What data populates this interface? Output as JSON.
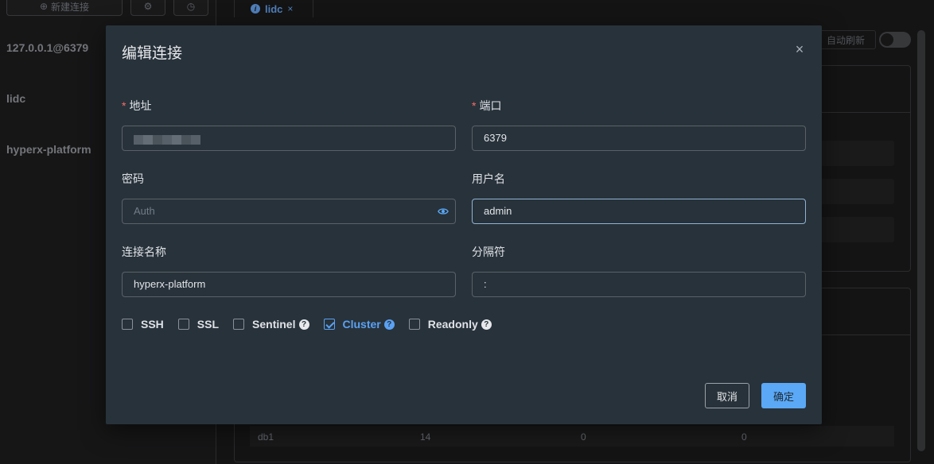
{
  "sidebar": {
    "new_connection_label": "新建连接",
    "connections": [
      {
        "label": "127.0.0.1@6379"
      },
      {
        "label": "lidc"
      },
      {
        "label": "hyperx-platform"
      }
    ]
  },
  "tab": {
    "label": "lidc",
    "close": "×"
  },
  "toolbar": {
    "auto_refresh_label": "自动刷新"
  },
  "db_row": {
    "name": "db1",
    "keys": "14",
    "expires": "0",
    "avg_ttl": "0"
  },
  "dialog": {
    "title": "编辑连接",
    "close": "×",
    "fields": {
      "address": {
        "label": "地址",
        "required_mark": "*"
      },
      "port": {
        "label": "端口",
        "required_mark": "*",
        "value": "6379"
      },
      "password": {
        "label": "密码",
        "placeholder": "Auth"
      },
      "username": {
        "label": "用户名",
        "value": "admin"
      },
      "conn_name": {
        "label": "连接名称",
        "value": "hyperx-platform"
      },
      "separator": {
        "label": "分隔符",
        "value": ":"
      }
    },
    "options": [
      {
        "label": "SSH",
        "checked": false,
        "help": false
      },
      {
        "label": "SSL",
        "checked": false,
        "help": false
      },
      {
        "label": "Sentinel",
        "checked": false,
        "help": true
      },
      {
        "label": "Cluster",
        "checked": true,
        "help": true
      },
      {
        "label": "Readonly",
        "checked": false,
        "help": true
      }
    ],
    "help_glyph": "?",
    "cancel_label": "取消",
    "ok_label": "确定"
  },
  "colors": {
    "accent": "#5aa8f6",
    "required": "#f56c6c",
    "dialog_bg": "#28323a"
  }
}
